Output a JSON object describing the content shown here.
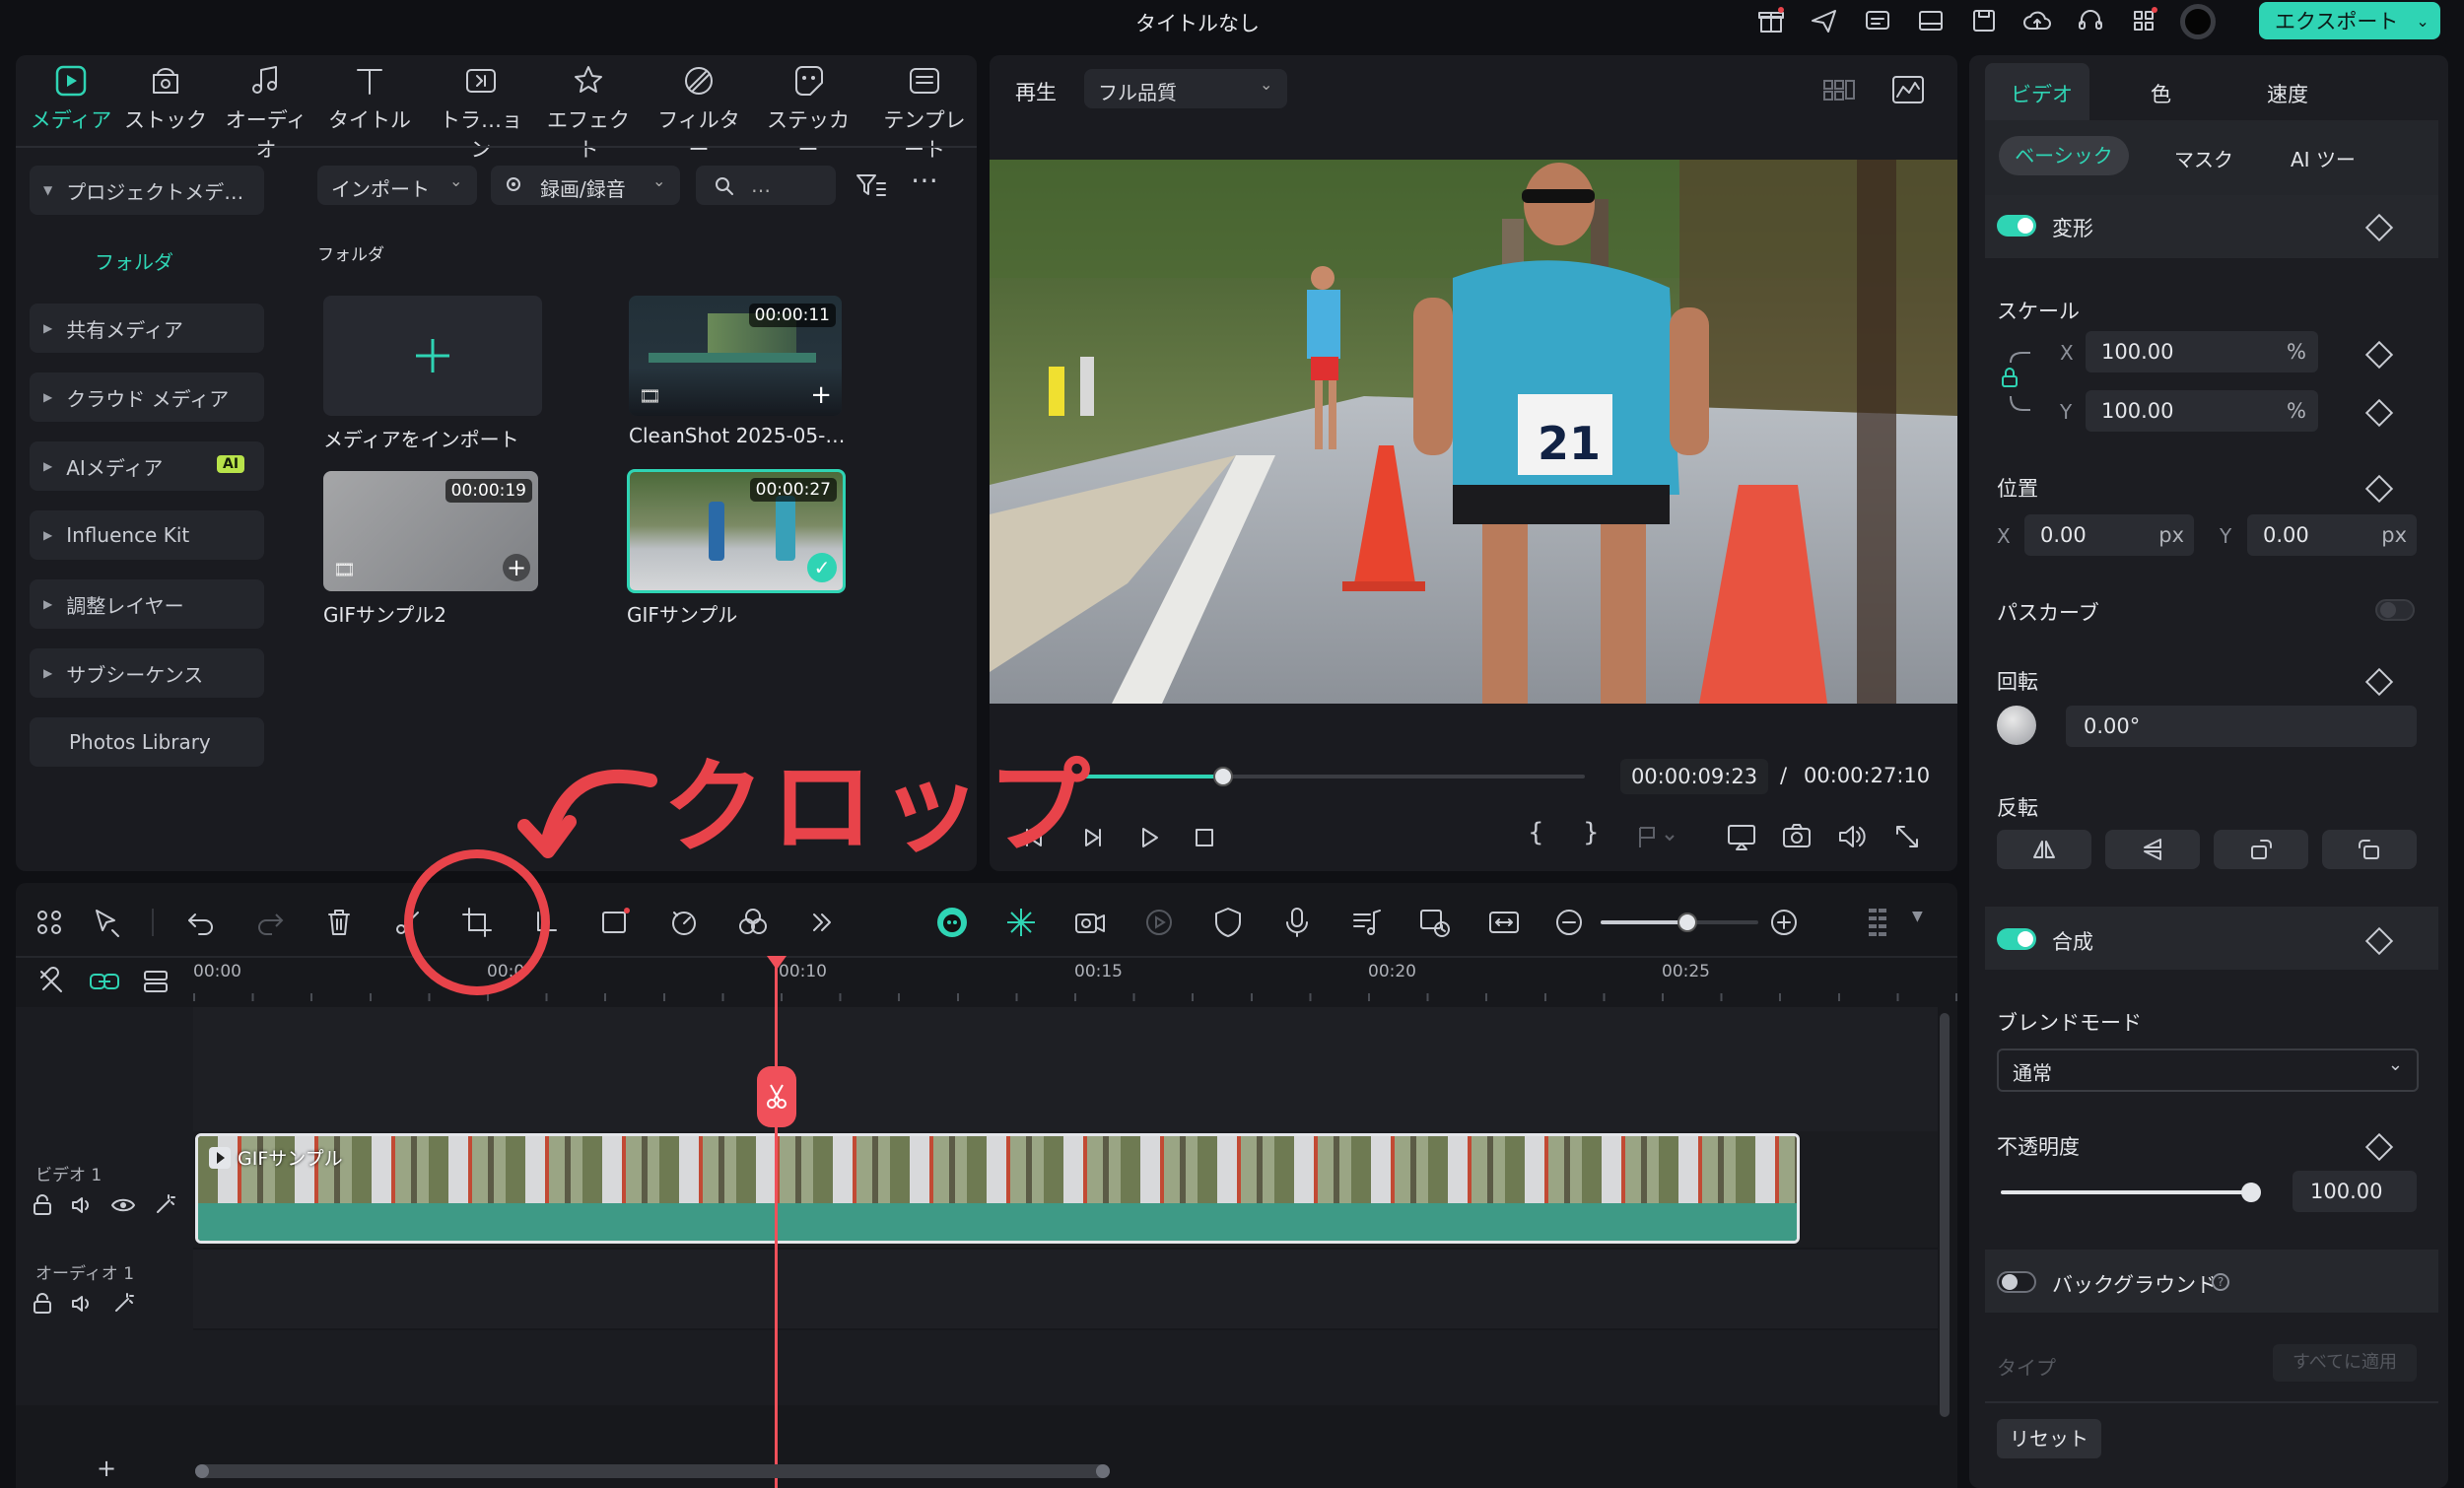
{
  "window": {
    "title": "タイトルなし",
    "export_label": "エクスポート"
  },
  "media_tabs": [
    {
      "label": "メディア",
      "icon": "media-icon"
    },
    {
      "label": "ストック",
      "icon": "stock-icon"
    },
    {
      "label": "オーディオ",
      "icon": "audio-icon"
    },
    {
      "label": "タイトル",
      "icon": "title-icon"
    },
    {
      "label": "トラ…ョン",
      "icon": "transition-icon"
    },
    {
      "label": "エフェクト",
      "icon": "effect-icon"
    },
    {
      "label": "フィルター",
      "icon": "filter-icon"
    },
    {
      "label": "ステッカー",
      "icon": "sticker-icon"
    },
    {
      "label": "テンプレート",
      "icon": "template-icon"
    }
  ],
  "sidebar": {
    "project_media": "プロジェクトメデ…",
    "folder": "フォルダ",
    "items": [
      "共有メディア",
      "クラウド メディア",
      "AIメディア",
      "Influence Kit",
      "調整レイヤー",
      "サブシーケンス",
      "Photos Library"
    ],
    "ai_badge": "AI"
  },
  "media_toolbar": {
    "import": "インポート",
    "record": "録画/録音",
    "search_placeholder": "…"
  },
  "library": {
    "folder_label": "フォルダ",
    "import_tile": "メディアをインポート",
    "clips": [
      {
        "name": "CleanShot 2025-05-…",
        "duration": "00:00:11"
      },
      {
        "name": "GIFサンプル2",
        "duration": "00:00:19"
      },
      {
        "name": "GIFサンプル",
        "duration": "00:00:27"
      }
    ]
  },
  "player": {
    "mode": "再生",
    "quality": "フル品質",
    "current_time": "00:00:09:23",
    "separator": "/",
    "total_time": "00:00:27:10",
    "progress": 0.36
  },
  "annotation": {
    "label": "クロップ"
  },
  "timeline": {
    "ruler": [
      "00:00",
      "00:0",
      "00:10",
      "00:15",
      "00:20",
      "00:25"
    ],
    "video_track": "ビデオ 1",
    "audio_track": "オーディオ 1",
    "clip_name": "GIFサンプル",
    "zoom": 0.55,
    "add_label": "+"
  },
  "inspector": {
    "tabs": [
      "ビデオ",
      "色",
      "速度"
    ],
    "subtabs": [
      "ベーシック",
      "マスク",
      "AI ツー"
    ],
    "transform": "変形",
    "scale": "スケール",
    "scale_x_label": "X",
    "scale_x": "100.00",
    "scale_y_label": "Y",
    "scale_y": "100.00",
    "percent": "%",
    "position": "位置",
    "pos_x_label": "X",
    "pos_x": "0.00",
    "pos_y_label": "Y",
    "pos_y": "0.00",
    "px": "px",
    "path_curve": "パスカーブ",
    "rotation": "回転",
    "rotation_value": "0.00°",
    "flip": "反転",
    "composite": "合成",
    "blend_mode": "ブレンドモード",
    "blend_value": "通常",
    "opacity": "不透明度",
    "opacity_value": "100.00",
    "opacity_level": 1.0,
    "background": "バックグラウンド",
    "type": "タイプ",
    "apply_all": "すべてに適用",
    "reset": "リセット"
  },
  "colors": {
    "accent": "#2fd4b4",
    "annotation": "#e8434a",
    "playhead": "#f0505a"
  }
}
